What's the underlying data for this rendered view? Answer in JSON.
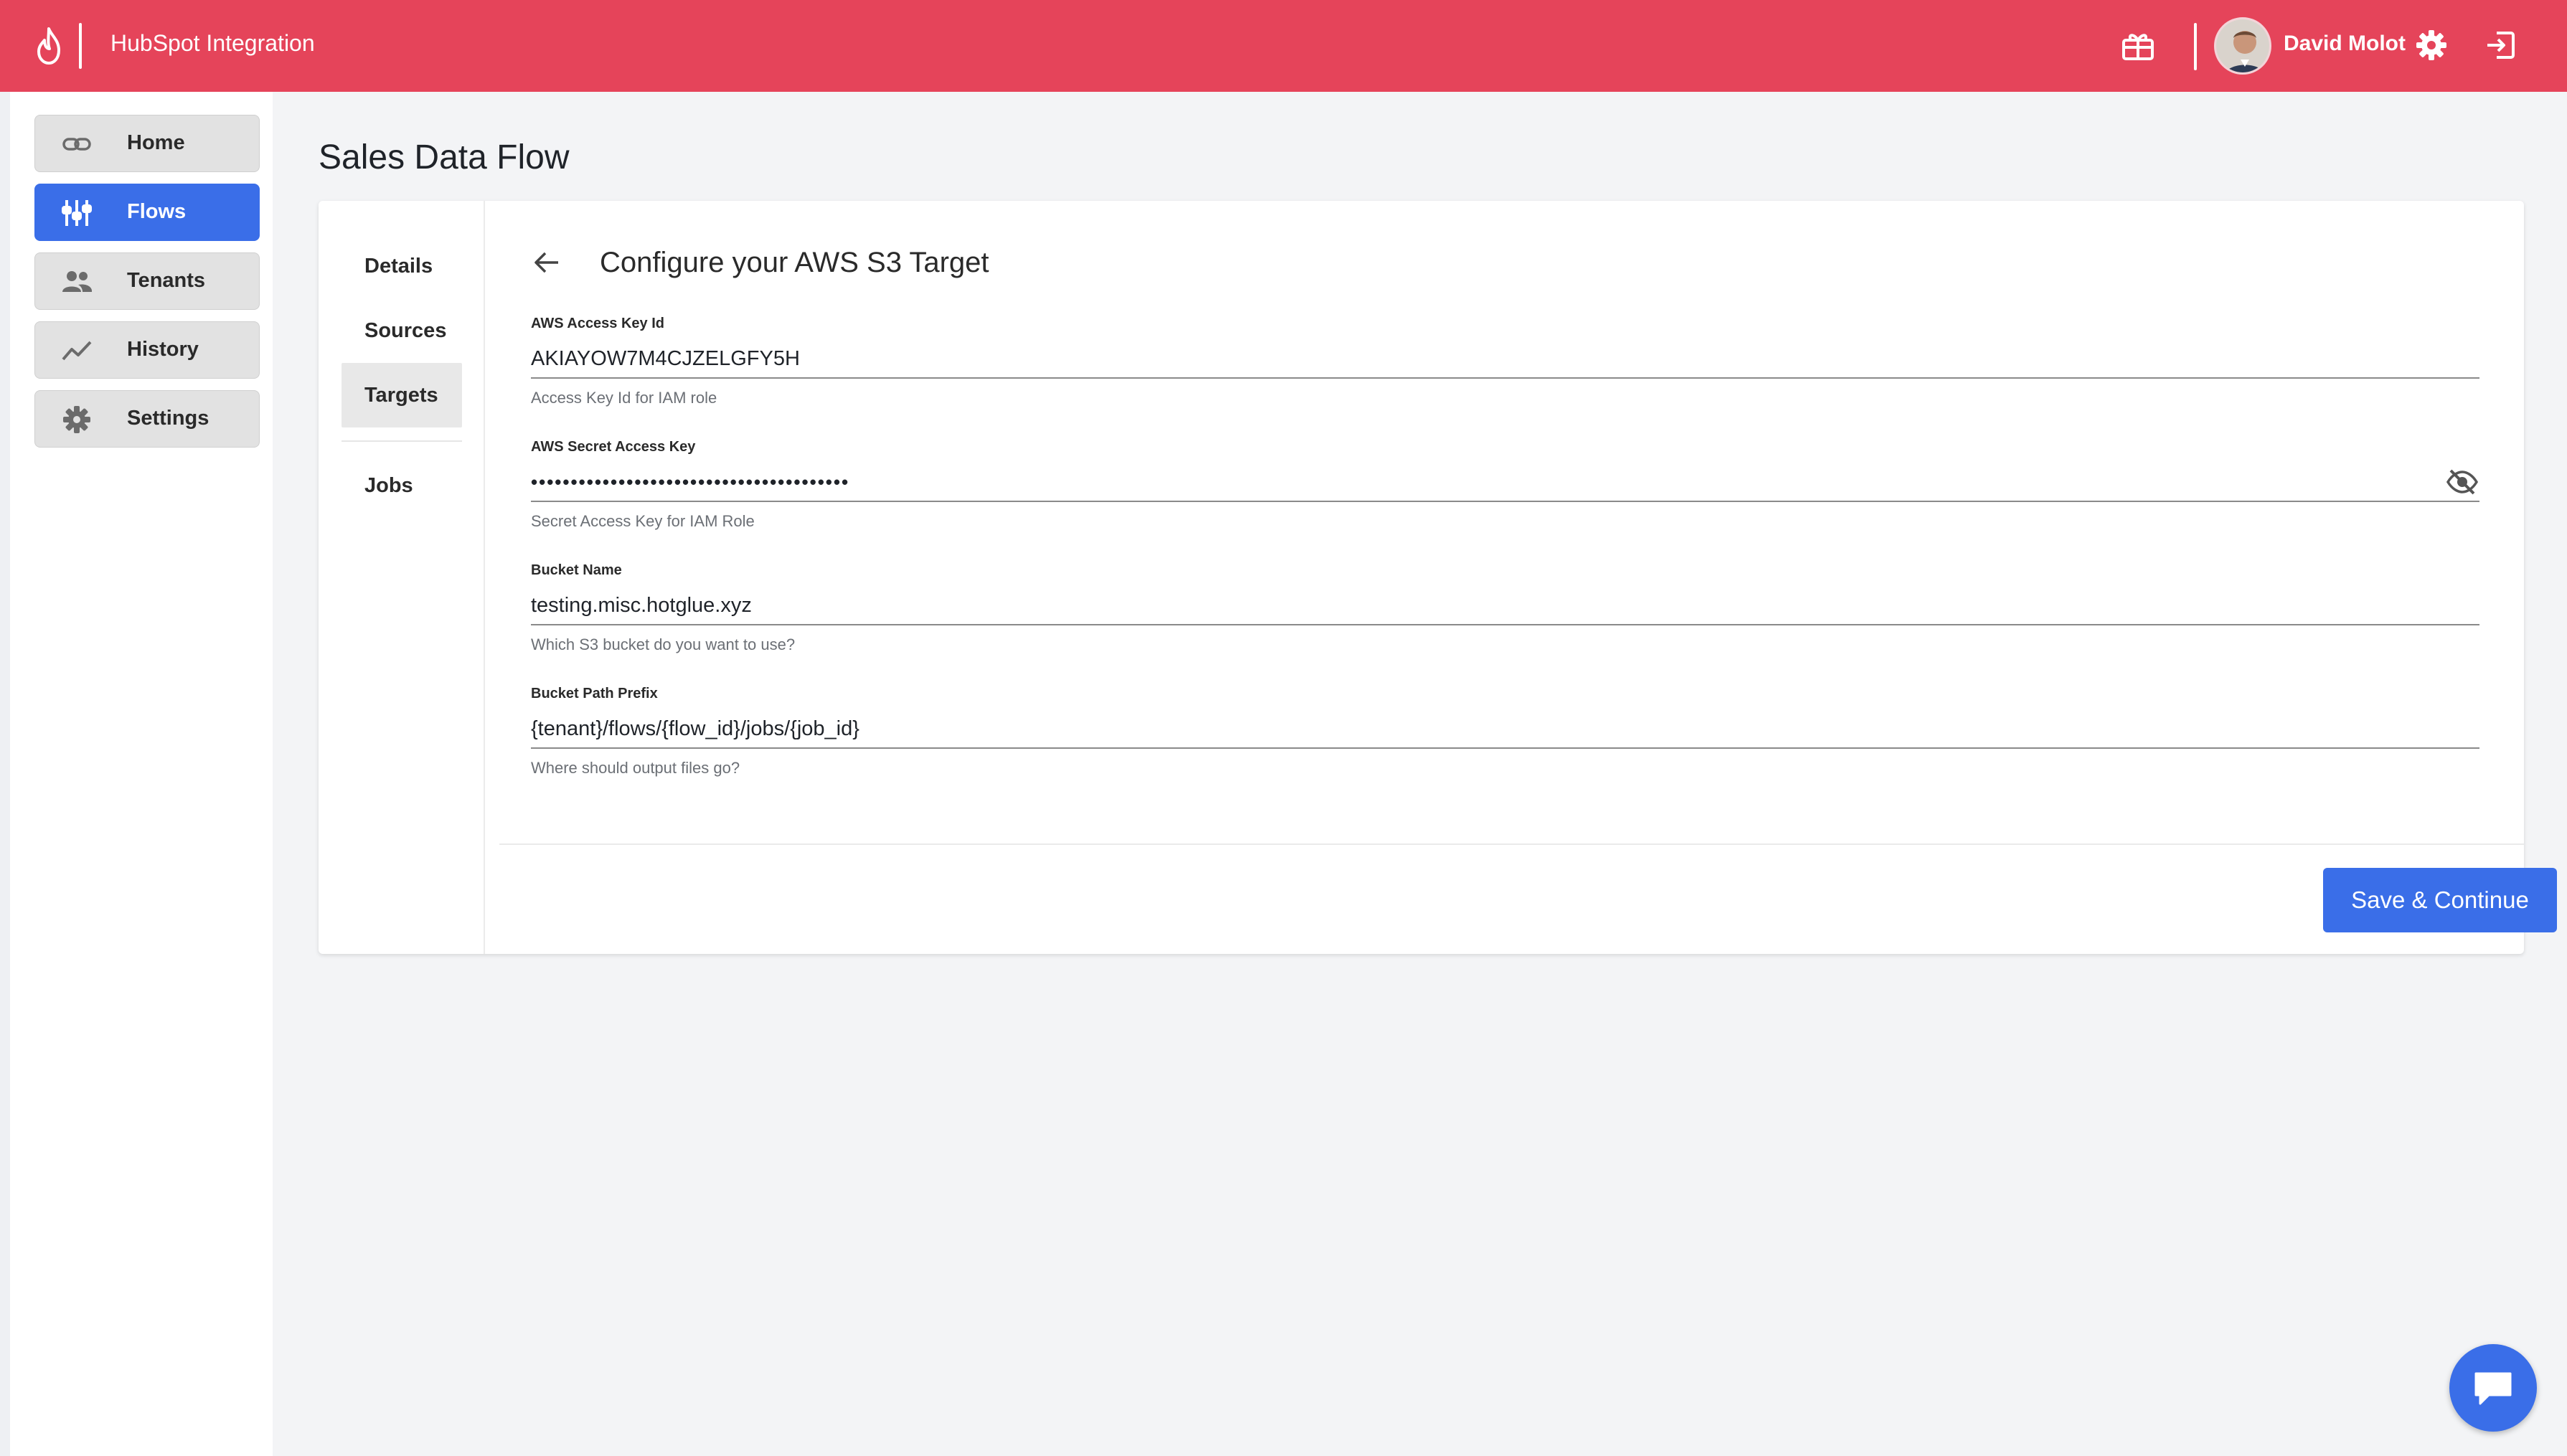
{
  "topbar": {
    "app_title": "HubSpot Integration",
    "user_name": "David Molot",
    "brand_color": "#e5445a"
  },
  "sidebar": {
    "items": [
      {
        "label": "Home",
        "icon": "link-icon",
        "active": false
      },
      {
        "label": "Flows",
        "icon": "flows-icon",
        "active": true
      },
      {
        "label": "Tenants",
        "icon": "people-icon",
        "active": false
      },
      {
        "label": "History",
        "icon": "chart-line-icon",
        "active": false
      },
      {
        "label": "Settings",
        "icon": "gear-icon",
        "active": false
      }
    ]
  },
  "main": {
    "page_title": "Sales Data Flow",
    "steps": [
      {
        "label": "Details",
        "active": false
      },
      {
        "label": "Sources",
        "active": false
      },
      {
        "label": "Targets",
        "active": true
      },
      {
        "label": "Jobs",
        "active": false
      }
    ],
    "section_title": "Configure your AWS S3 Target",
    "fields": [
      {
        "label": "AWS Access Key Id",
        "value": "AKIAYOW7M4CJZELGFY5H",
        "help": "Access Key Id for IAM role"
      },
      {
        "label": "AWS Secret Access Key",
        "value": "••••••••••••••••••••••••••••••••••••••••",
        "help": "Secret Access Key for IAM Role"
      },
      {
        "label": "Bucket Name",
        "value": "testing.misc.hotglue.xyz",
        "help": "Which S3 bucket do you want to use?"
      },
      {
        "label": "Bucket Path Prefix",
        "value": "{tenant}/flows/{flow_id}/jobs/{job_id}",
        "help": "Where should output files go?"
      }
    ],
    "save_label": "Save & Continue",
    "accent_color": "#3a6ee8"
  }
}
